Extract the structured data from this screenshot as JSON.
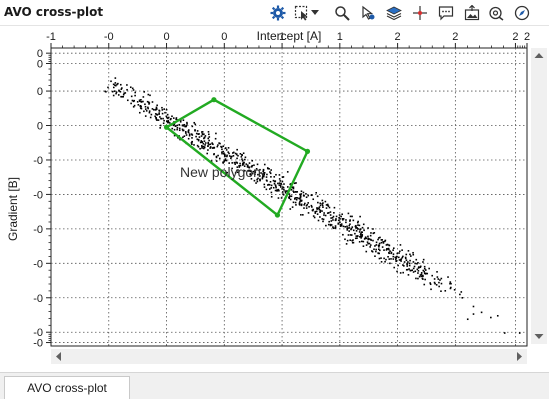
{
  "window": {
    "title": "AVO cross-plot"
  },
  "toolbar": {
    "icons": [
      "gear-icon",
      "selection-mode-icon",
      "dropdown-arrow-icon",
      "zoom-icon",
      "pick-icon",
      "layers-icon",
      "crosshair-icon",
      "annotation-icon",
      "export-image-icon",
      "find-icon",
      "compass-icon"
    ]
  },
  "tab": {
    "label": "AVO cross-plot"
  },
  "chart_data": {
    "type": "scatter",
    "xlabel": "Intercept [A]",
    "ylabel": "Gradient [B]",
    "xlim": [
      -1.15,
      2.25
    ],
    "ylim": [
      -0.155,
      0.015
    ],
    "x_ticks": [
      {
        "v": -1.1,
        "label": "-1"
      },
      {
        "v": -0.5,
        "label": "-0"
      },
      {
        "v": 0,
        "label": "0"
      },
      {
        "v": 0.5,
        "label": "0"
      },
      {
        "v": 1,
        "label": "1"
      },
      {
        "v": 1.5,
        "label": "1"
      },
      {
        "v": 2,
        "label": "2"
      },
      {
        "v": 2.5,
        "label": "2"
      },
      {
        "v": 3.0,
        "label": "2"
      },
      {
        "v": 3.2,
        "label": "2"
      }
    ],
    "x_ticks_display": [
      {
        "v": -1.1,
        "label": "-1"
      },
      {
        "v": -0.6,
        "label": "-0"
      },
      {
        "v": -0.1,
        "label": "0"
      },
      {
        "v": 0.4,
        "label": "0"
      },
      {
        "v": 0.9,
        "label": "1"
      },
      {
        "v": 1.4,
        "label": "1"
      },
      {
        "v": 1.9,
        "label": "2"
      },
      {
        "v": 2.4,
        "label": "2"
      },
      {
        "v": 2.92,
        "label": "2"
      },
      {
        "v": 3.02,
        "label": "2"
      }
    ],
    "y_ticks_display": [
      {
        "v": 0.012,
        "label": "0"
      },
      {
        "v": 0.006,
        "label": "0"
      },
      {
        "v": -0.01,
        "label": "0"
      },
      {
        "v": -0.03,
        "label": "0"
      },
      {
        "v": -0.05,
        "label": "-0"
      },
      {
        "v": -0.07,
        "label": "-0"
      },
      {
        "v": -0.09,
        "label": "-0"
      },
      {
        "v": -0.11,
        "label": "-0"
      },
      {
        "v": -0.13,
        "label": "-0"
      },
      {
        "v": -0.15,
        "label": "-0"
      },
      {
        "v": -0.156,
        "label": "-0"
      }
    ],
    "grid": true,
    "polygon": {
      "label": "New polygon",
      "color": "#22aa22",
      "vertices": [
        [
          -0.1,
          -0.031
        ],
        [
          0.31,
          -0.015
        ],
        [
          1.12,
          -0.045
        ],
        [
          0.86,
          -0.082
        ]
      ]
    },
    "point_color": "#000000",
    "cloud": {
      "trend_start": [
        -0.55,
        -0.008
      ],
      "trend_end": [
        2.95,
        -0.148
      ],
      "count": 900
    }
  }
}
